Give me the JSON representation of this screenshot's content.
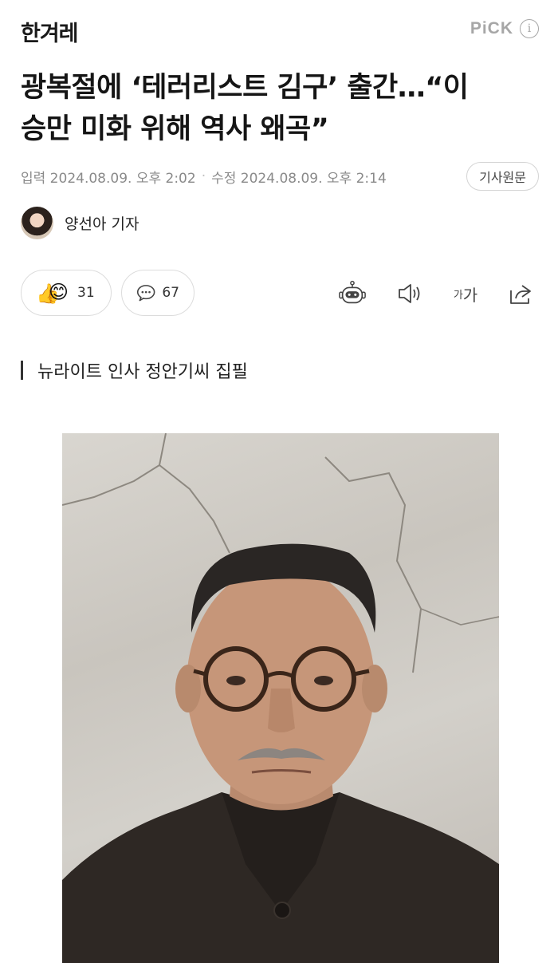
{
  "header": {
    "logo": "한겨레",
    "pick_label": "PiCK",
    "info_icon": "i"
  },
  "article": {
    "headline_line1": "광복절에 ‘테러리스트 김구’ 출간…“이",
    "headline_line2": "승만 미화 위해 역사 왜곡”",
    "published_label": "입력 2024.08.09. 오후 2:02",
    "separator": "·",
    "modified_label": "수정 2024.08.09. 오후 2:14",
    "original_button": "기사원문",
    "author": "양선아 기자",
    "subtitle": "뉴라이트 인사 정안기씨 집필"
  },
  "actions": {
    "reactions_count": "31",
    "comments_count": "67",
    "font_size_small": "가",
    "font_size_large": "가",
    "icons": [
      "reaction-emoji-icon",
      "comment-bubble-icon",
      "summary-bot-icon",
      "speaker-icon",
      "font-size-icon",
      "share-icon"
    ]
  },
  "colors": {
    "muted_text": "#8a8a8a",
    "pick_gray": "#a6a6a6",
    "border": "#dcdcdc"
  }
}
